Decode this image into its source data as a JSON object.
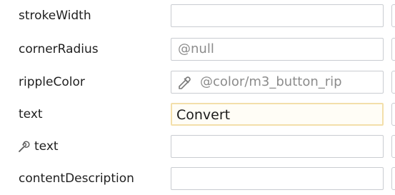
{
  "attributes": [
    {
      "name": "strokeWidth",
      "value": "",
      "has_picker": false,
      "has_wrench": false,
      "active": false
    },
    {
      "name": "cornerRadius",
      "value": "@null",
      "has_picker": false,
      "has_wrench": false,
      "active": false
    },
    {
      "name": "rippleColor",
      "value": "@color/m3_button_rip",
      "has_picker": true,
      "has_wrench": false,
      "active": false
    },
    {
      "name": "text",
      "value": "Convert",
      "has_picker": false,
      "has_wrench": false,
      "active": true
    },
    {
      "name": "text",
      "value": "",
      "has_picker": false,
      "has_wrench": true,
      "active": false
    },
    {
      "name": "contentDescription",
      "value": "",
      "has_picker": false,
      "has_wrench": false,
      "active": false
    }
  ],
  "colors": {
    "active_field_border": "#f3dfaa",
    "field_border": "#c9ccd1",
    "placeholder_text": "#8c8c8c"
  },
  "icons": {
    "picker": "eyedropper-icon",
    "tools": "wrench-icon"
  }
}
